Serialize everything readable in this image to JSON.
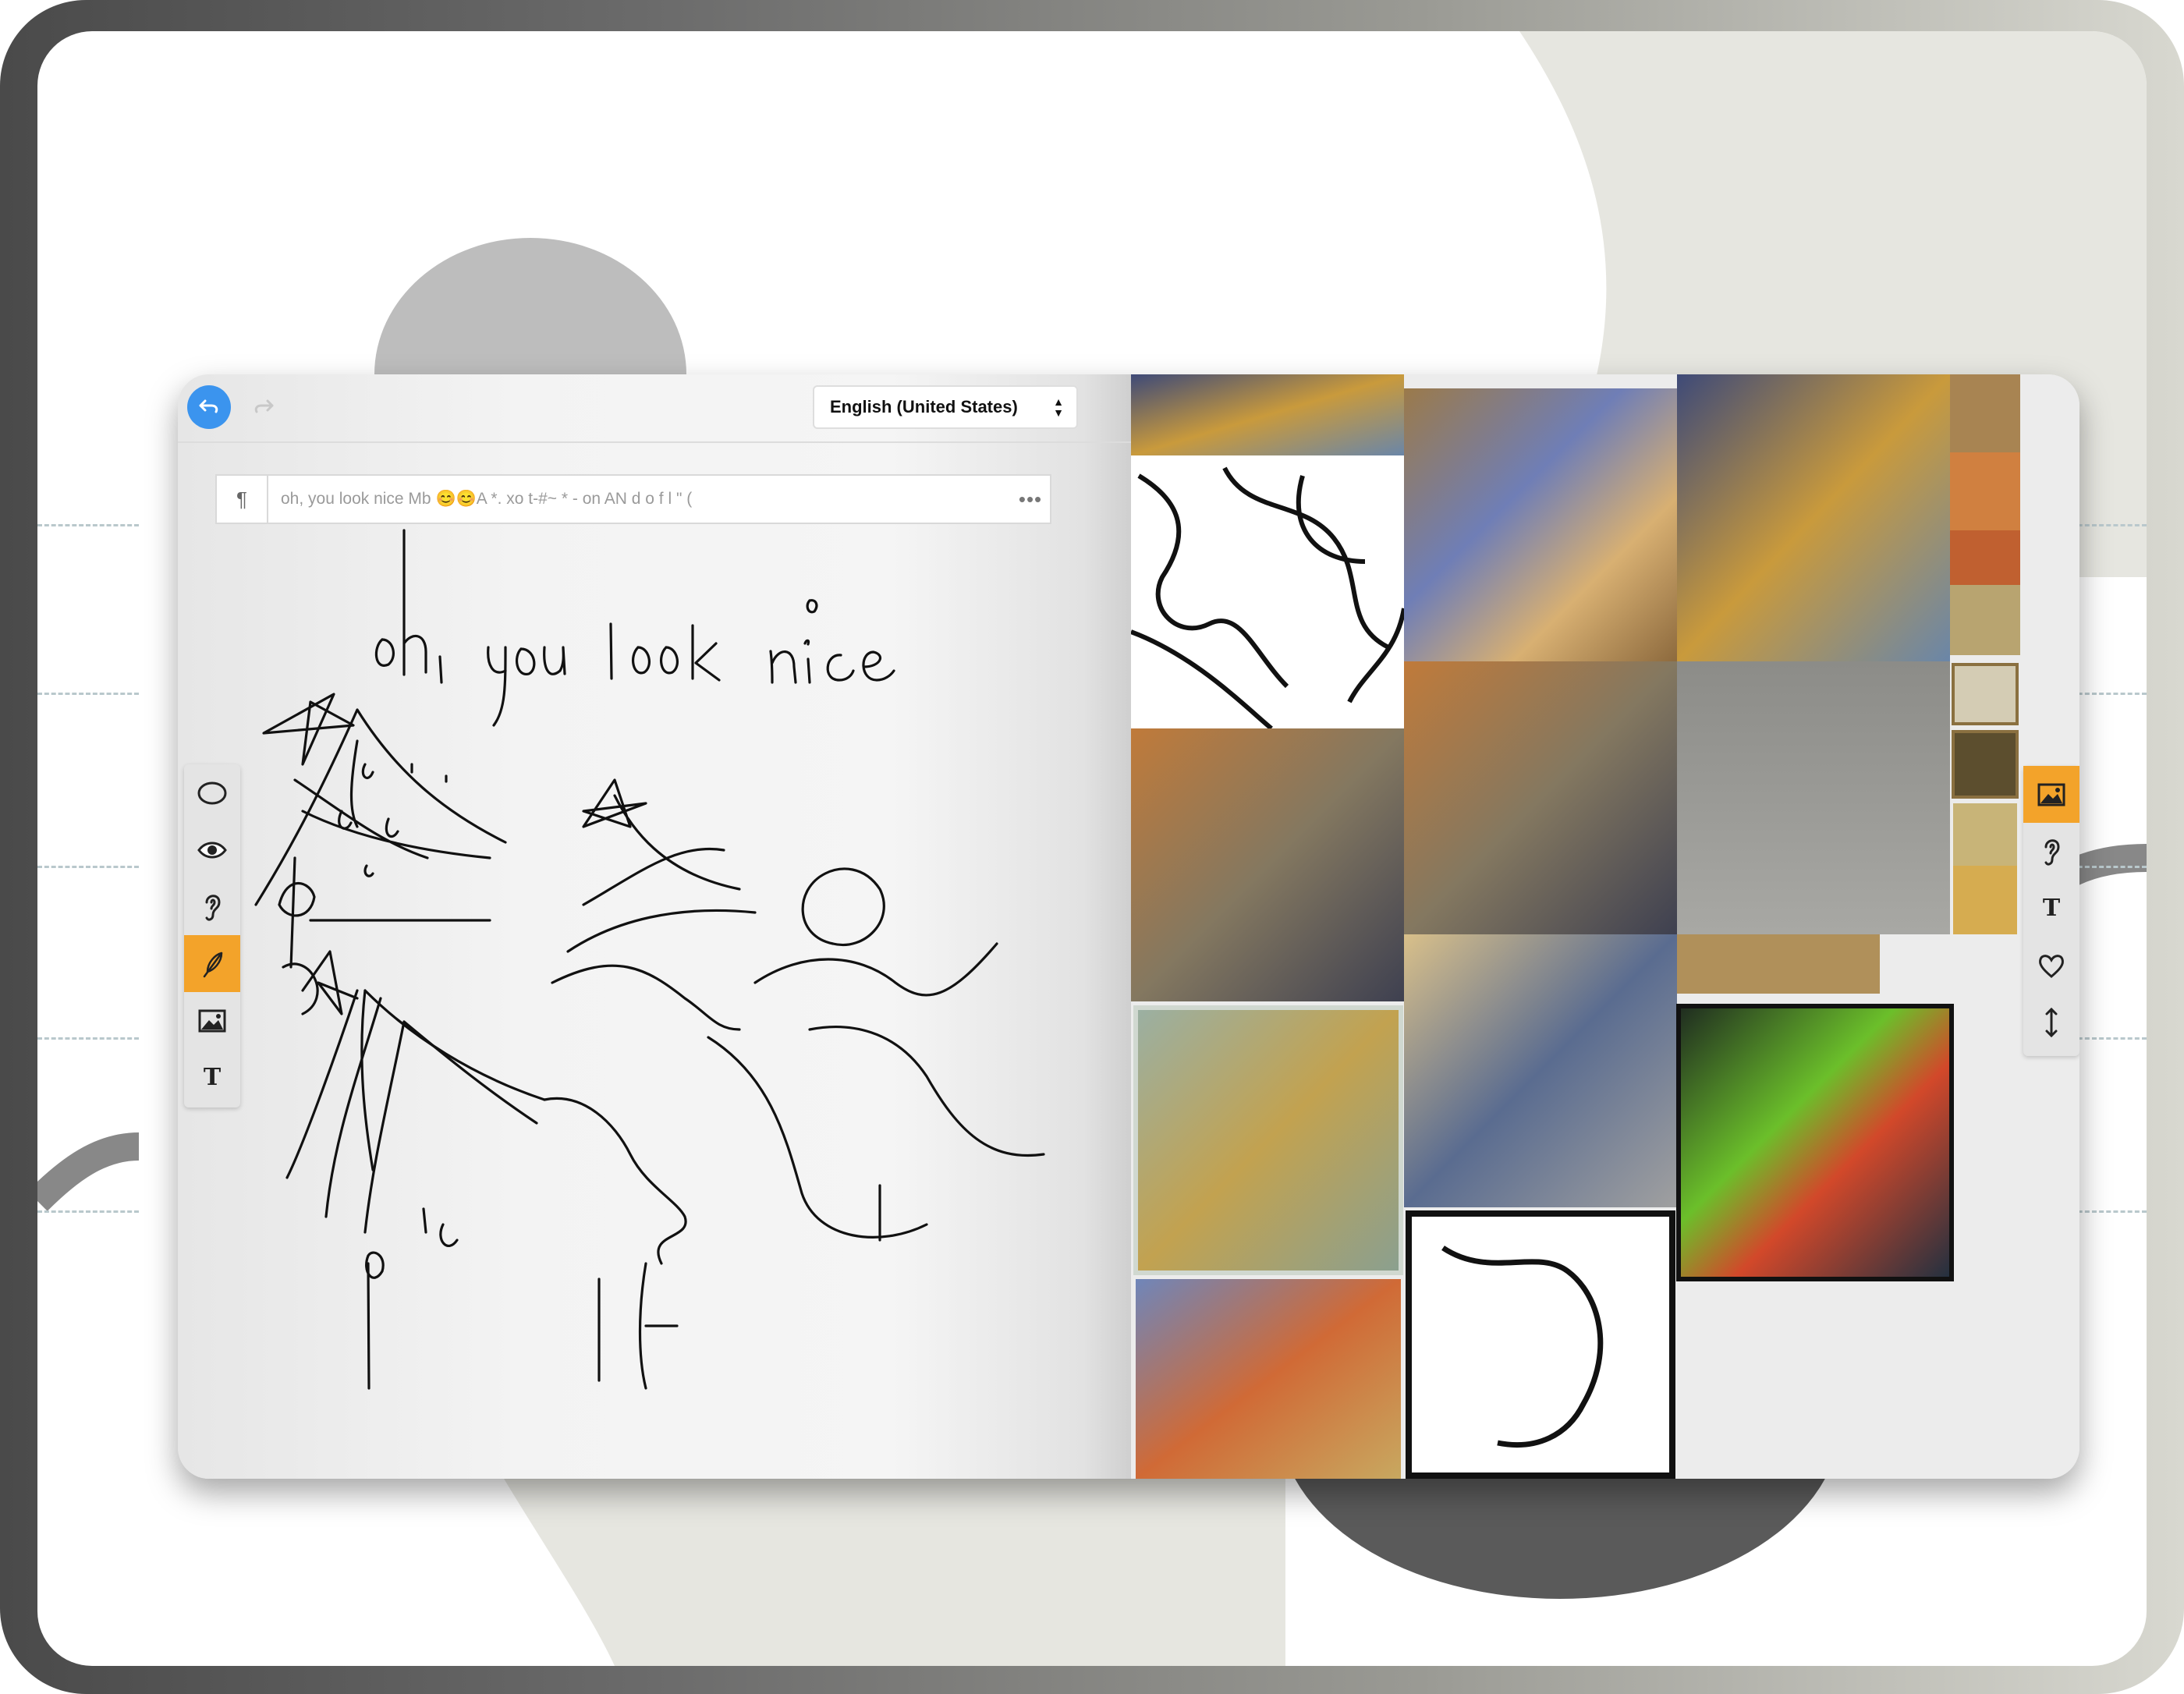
{
  "toolbar": {
    "undo_icon": "undo-arrow-icon",
    "redo_icon": "redo-arrow-icon",
    "language": "English (United States)"
  },
  "text_bar": {
    "paragraph_symbol": "¶",
    "recognized_text": "oh, you look nice Mb 😊😊A *. xo t-#~ * - on AN d o f l \" (",
    "more": "•••"
  },
  "handwriting": "ohi you look nice",
  "left_tools": [
    {
      "name": "lasso-tool",
      "glyph": "○",
      "active": false
    },
    {
      "name": "eye-tool",
      "glyph": "👁",
      "active": false
    },
    {
      "name": "ear-tool",
      "glyph": "§",
      "active": false
    },
    {
      "name": "pen-tool",
      "glyph": "✎",
      "active": true
    },
    {
      "name": "image-tool",
      "glyph": "▣",
      "active": false
    },
    {
      "name": "text-tool",
      "glyph": "T",
      "active": false
    }
  ],
  "right_tools": [
    {
      "name": "image-tool",
      "glyph": "▣",
      "active": true
    },
    {
      "name": "ear-tool",
      "glyph": "§",
      "active": false
    },
    {
      "name": "text-tool",
      "glyph": "T",
      "active": false
    },
    {
      "name": "heart-tool",
      "glyph": "♡",
      "active": false
    },
    {
      "name": "resize-tool",
      "glyph": "↕",
      "active": false
    }
  ],
  "colors": {
    "accent": "#f3a32a",
    "undo_button": "#3b94ee",
    "page": "#f3f3f3"
  }
}
